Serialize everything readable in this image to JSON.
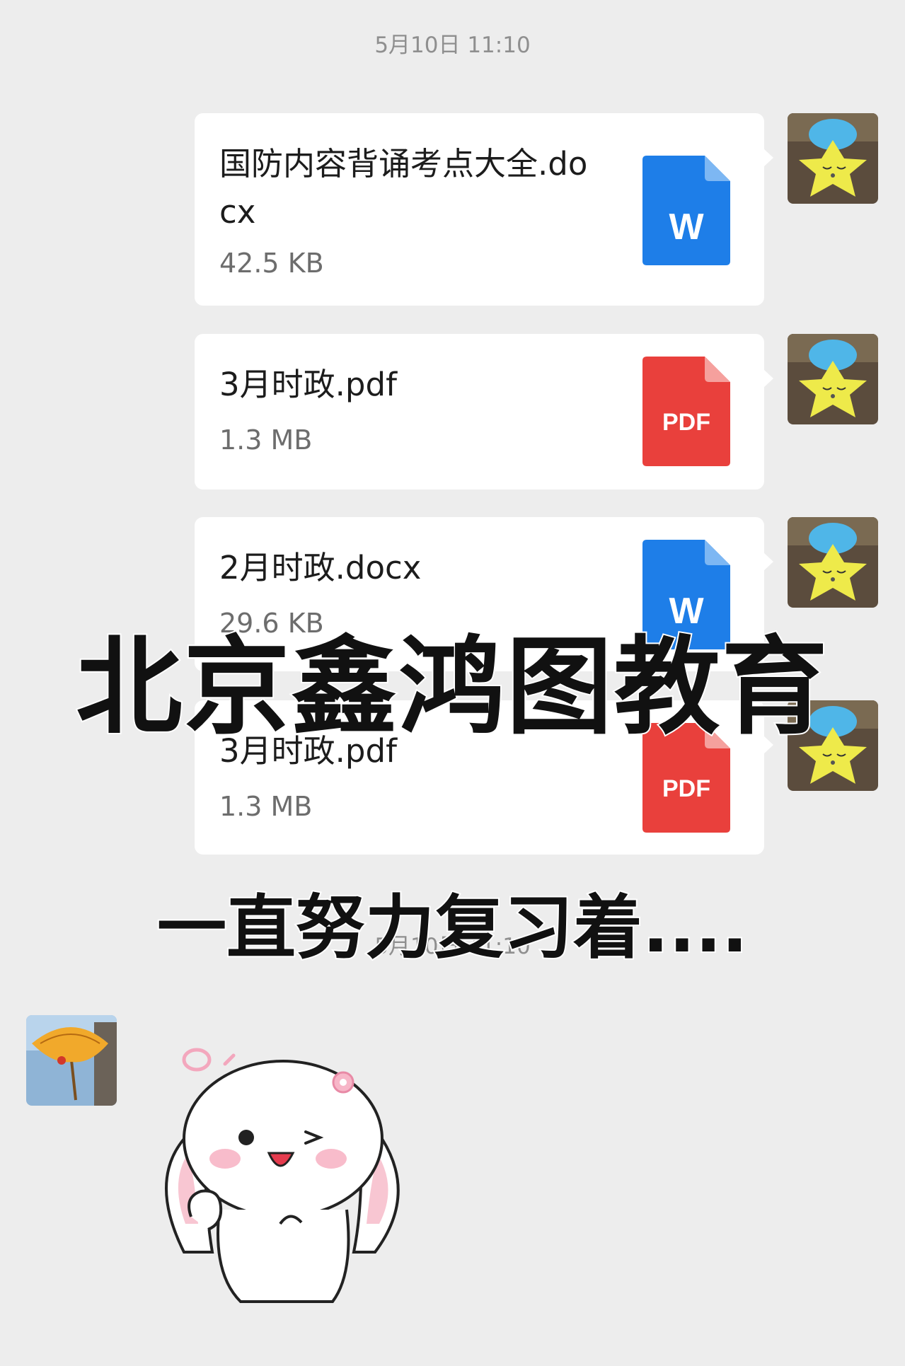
{
  "chat": {
    "timestamp_top": "5月10日 11:10",
    "timestamp_bottom": "5月10日 11:10",
    "messages": [
      {
        "file_name": "国防内容背诵考点大全.docx",
        "file_size": "42.5 KB",
        "file_type": "word",
        "icon_label": "W",
        "icon_color": "#1e7ee8"
      },
      {
        "file_name": "3月时政.pdf",
        "file_size": "1.3 MB",
        "file_type": "pdf",
        "icon_label": "PDF",
        "icon_color": "#e9403c"
      },
      {
        "file_name": "2月时政.docx",
        "file_size": "29.6 KB",
        "file_type": "word",
        "icon_label": "W",
        "icon_color": "#1e7ee8"
      },
      {
        "file_name": "3月时政.pdf",
        "file_size": "1.3 MB",
        "file_type": "pdf",
        "icon_label": "PDF",
        "icon_color": "#e9403c"
      }
    ],
    "sticker": "white-bunny-wink-sticker"
  },
  "overlay": {
    "title": "北京鑫鸿图教育",
    "subtitle": "一直努力复习着...."
  }
}
